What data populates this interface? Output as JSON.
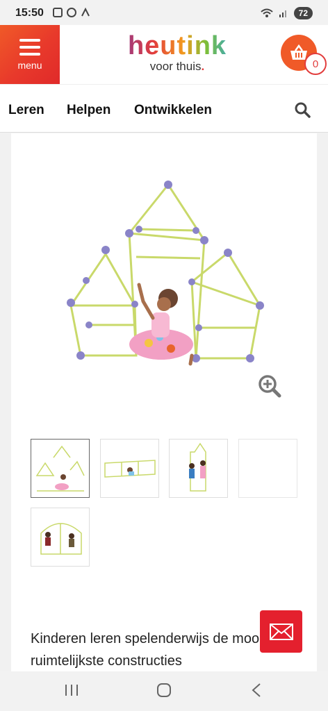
{
  "status_bar": {
    "time": "15:50",
    "battery": "72"
  },
  "header": {
    "menu_label": "menu",
    "brand": "heutink",
    "tagline": "voor thuis",
    "tagline_dot": ".",
    "cart_count": "0"
  },
  "nav": {
    "items": [
      "Leren",
      "Helpen",
      "Ontwikkelen"
    ]
  },
  "product": {
    "description": "Kinderen leren spelenderwijs de mooiste en ruimtelijkste constructies"
  },
  "colors": {
    "accent": "#e4202e",
    "brand_orange": "#f05a28",
    "frame_green": "#c9d96a",
    "connector_purple": "#8a84c8"
  },
  "icons": [
    "hamburger-icon",
    "basket-icon",
    "search-icon",
    "zoom-in-icon",
    "mail-icon",
    "recent-apps-icon",
    "home-icon",
    "back-icon"
  ]
}
